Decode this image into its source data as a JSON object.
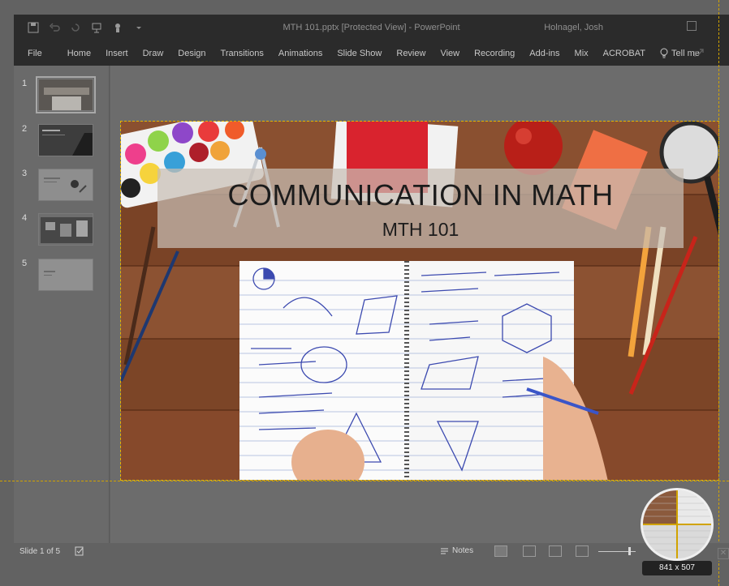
{
  "window": {
    "title": "MTH 101.pptx [Protected View]  -  PowerPoint",
    "user": "Holnagel, Josh"
  },
  "ribbon": {
    "tabs": [
      "File",
      "Home",
      "Insert",
      "Draw",
      "Design",
      "Transitions",
      "Animations",
      "Slide Show",
      "Review",
      "View",
      "Recording",
      "Add-ins",
      "Mix",
      "ACROBAT"
    ],
    "tell_me": "Tell me"
  },
  "thumbnails": {
    "numbers": [
      "1",
      "2",
      "3",
      "4",
      "5"
    ],
    "active": 1
  },
  "slide": {
    "title": "COMMUNICATION IN MATH",
    "subtitle": "MTH 101"
  },
  "statusbar": {
    "slide_info": "Slide 1 of 5",
    "notes_label": "Notes"
  },
  "magnifier": {
    "size_label": "841 x 507"
  },
  "colors": {
    "chrome": "#2b2b2b",
    "guide": "#d1a300",
    "wood": "#8a4f2b"
  }
}
